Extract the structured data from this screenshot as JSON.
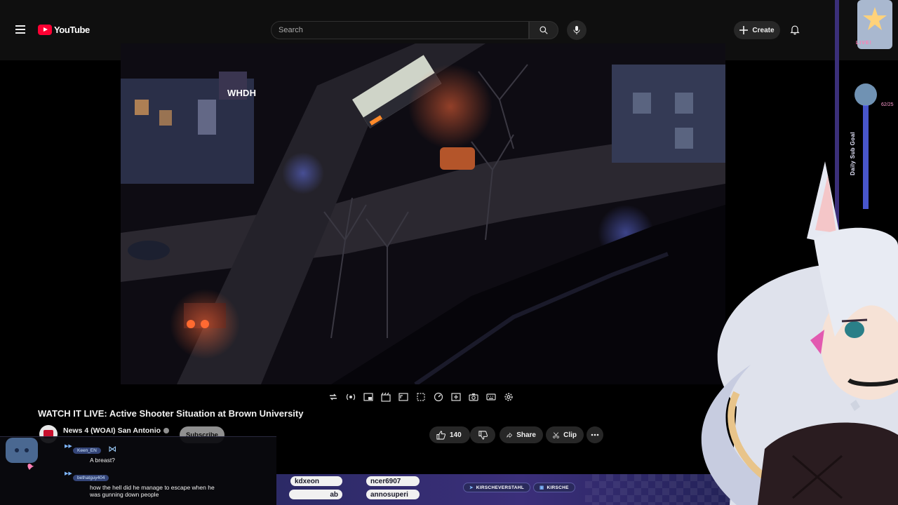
{
  "app": {
    "logo_text": "YouTube"
  },
  "header": {
    "search_placeholder": "Search",
    "create_label": "Create"
  },
  "video": {
    "watermark": "WHDH",
    "title": "WATCH IT LIVE: Active Shooter Situation at Brown University",
    "channel_name": "News 4 (WOAI) San Antonio",
    "subscribe_label": "Subscribe",
    "likes": "140",
    "share_label": "Share",
    "clip_label": "Clip"
  },
  "chat": {
    "messages": [
      {
        "user": "Keen_EN",
        "text": "A breast?"
      },
      {
        "user": "bethatguy404",
        "text": "how the hell did he manage to escape when he was gunning down people"
      }
    ]
  },
  "overlay": {
    "ticker": [
      "kdxeon",
      "ncer6907",
      "ab",
      "annosuperi"
    ],
    "social": [
      "KIRSCHEVERSTAHL",
      "KIRSCHE"
    ],
    "live_label": "LIVE!",
    "sub_goal_label": "Daily Sub Goal",
    "sub_goal_count": "62/25"
  },
  "colors": {
    "brand_red": "#ff0033",
    "header_bg": "#0f0f0f",
    "accent_purple": "#3b2f7a"
  }
}
